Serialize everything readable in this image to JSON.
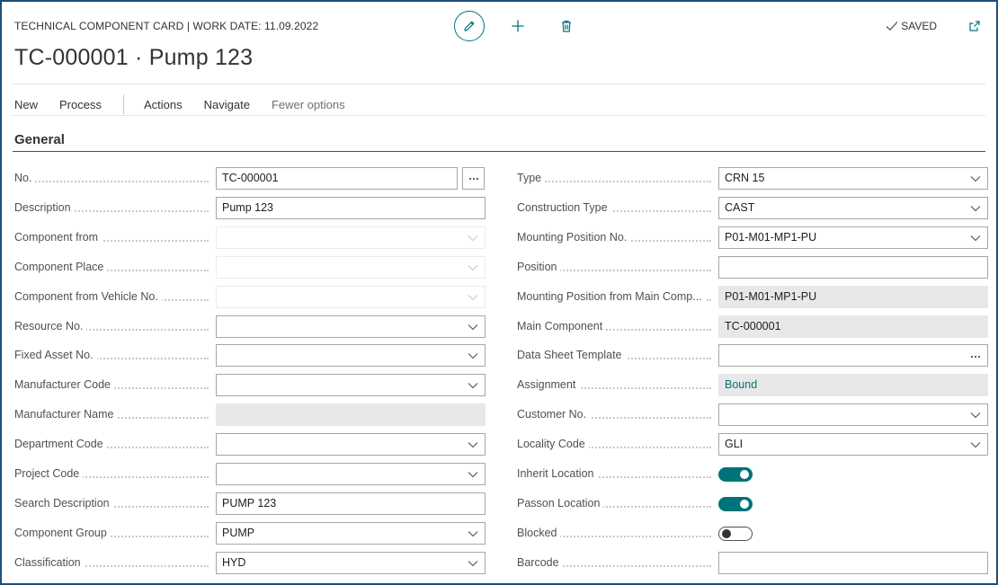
{
  "header": {
    "caption": "TECHNICAL COMPONENT CARD | WORK DATE: 11.09.2022",
    "title": "TC-000001 · Pump 123",
    "saved_label": "SAVED",
    "icons": [
      "pencil-icon",
      "plus-icon",
      "trash-icon",
      "checkmark-icon",
      "popout-icon"
    ]
  },
  "menu": {
    "items": [
      "New",
      "Process",
      "Actions",
      "Navigate"
    ],
    "fewer_options": "Fewer options"
  },
  "section": {
    "title": "General"
  },
  "left_fields": [
    {
      "label": "No.",
      "value": "TC-000001",
      "kind": "text-assist"
    },
    {
      "label": "Description",
      "value": "Pump 123",
      "kind": "text"
    },
    {
      "label": "Component from",
      "value": "",
      "kind": "select-disabled"
    },
    {
      "label": "Component Place",
      "value": "",
      "kind": "select-disabled"
    },
    {
      "label": "Component from Vehicle No.",
      "value": "",
      "kind": "select-disabled"
    },
    {
      "label": "Resource No.",
      "value": "",
      "kind": "select"
    },
    {
      "label": "Fixed Asset No.",
      "value": "",
      "kind": "select"
    },
    {
      "label": "Manufacturer Code",
      "value": "",
      "kind": "select"
    },
    {
      "label": "Manufacturer Name",
      "value": "",
      "kind": "readonly"
    },
    {
      "label": "Department Code",
      "value": "",
      "kind": "select"
    },
    {
      "label": "Project Code",
      "value": "",
      "kind": "select"
    },
    {
      "label": "Search Description",
      "value": "PUMP 123",
      "kind": "text"
    },
    {
      "label": "Component Group",
      "value": "PUMP",
      "kind": "select"
    },
    {
      "label": "Classification",
      "value": "HYD",
      "kind": "select"
    }
  ],
  "right_fields": [
    {
      "label": "Type",
      "value": "CRN 15",
      "kind": "select"
    },
    {
      "label": "Construction Type",
      "value": "CAST",
      "kind": "select"
    },
    {
      "label": "Mounting Position No.",
      "value": "P01-M01-MP1-PU",
      "kind": "select"
    },
    {
      "label": "Position",
      "value": "",
      "kind": "text"
    },
    {
      "label": "Mounting Position from Main Comp...",
      "value": "P01-M01-MP1-PU",
      "kind": "readonly"
    },
    {
      "label": "Main Component",
      "value": "TC-000001",
      "kind": "readonly"
    },
    {
      "label": "Data Sheet Template",
      "value": "",
      "kind": "text-ellipsis"
    },
    {
      "label": "Assignment",
      "value": "Bound",
      "kind": "readonly-link"
    },
    {
      "label": "Customer No.",
      "value": "",
      "kind": "select"
    },
    {
      "label": "Locality Code",
      "value": "GLI",
      "kind": "select"
    },
    {
      "label": "Inherit Location",
      "value": "",
      "kind": "toggle",
      "checked": true
    },
    {
      "label": "Passon Location",
      "value": "",
      "kind": "toggle",
      "checked": true
    },
    {
      "label": "Blocked",
      "value": "",
      "kind": "toggle",
      "checked": false
    },
    {
      "label": "Barcode",
      "value": "",
      "kind": "text"
    }
  ],
  "colors": {
    "accent": "#00737a",
    "frame": "#1f4e79",
    "readonly_bg": "#e8e8e8"
  }
}
